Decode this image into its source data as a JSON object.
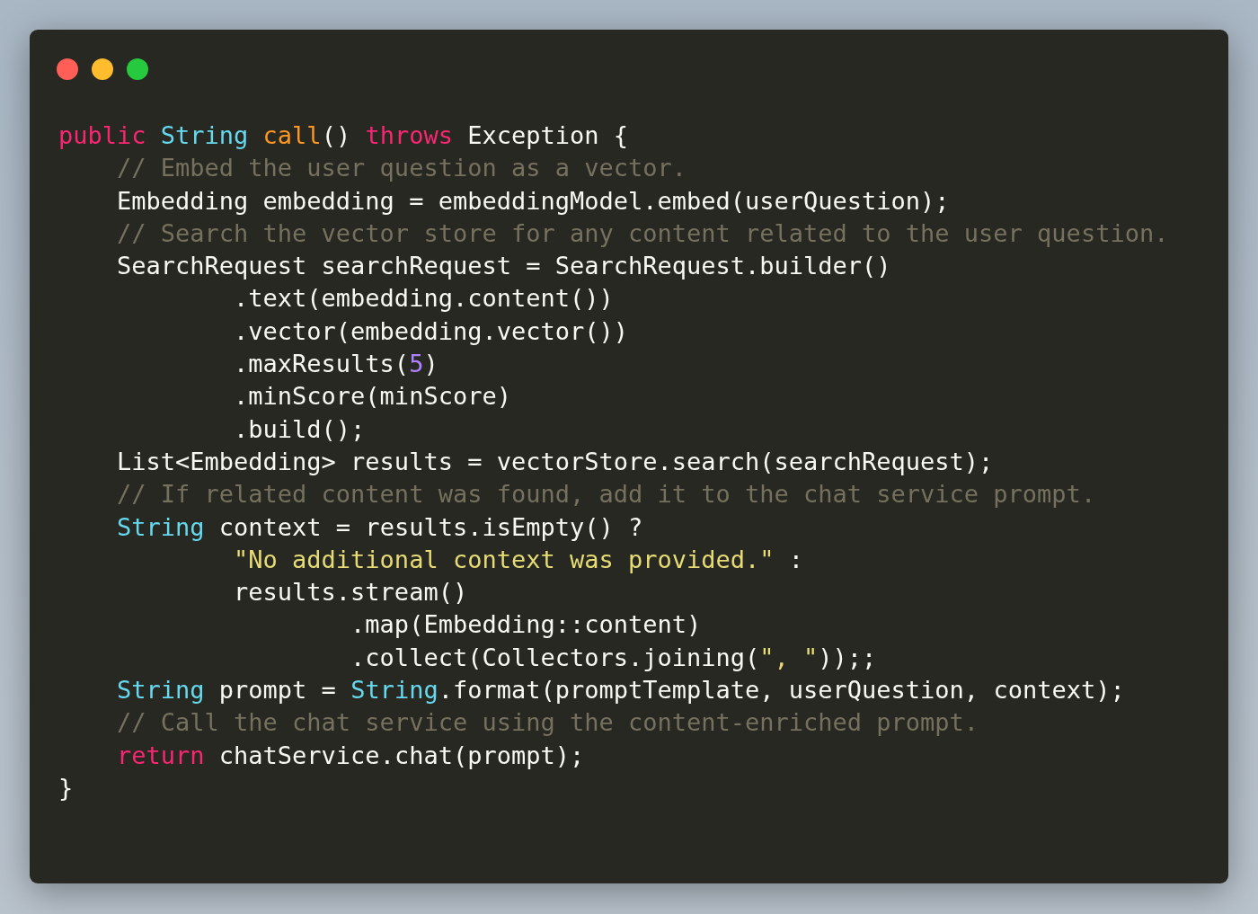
{
  "window": {
    "controls": [
      {
        "color": "#ff5f56"
      },
      {
        "color": "#ffbd2e"
      },
      {
        "color": "#27c93f"
      }
    ]
  },
  "code": [
    {
      "tokens": [
        {
          "kind": "keyword",
          "text": "public"
        },
        {
          "kind": "type",
          "text": " String"
        },
        {
          "kind": "function",
          "text": " call"
        },
        {
          "kind": "plain",
          "text": "() "
        },
        {
          "kind": "keyword",
          "text": "throws"
        },
        {
          "kind": "plain",
          "text": " Exception {"
        }
      ]
    },
    {
      "tokens": [
        {
          "kind": "comment",
          "text": "    // Embed the user question as a vector."
        }
      ]
    },
    {
      "tokens": [
        {
          "kind": "plain",
          "text": "    Embedding embedding = embeddingModel.embed(userQuestion);"
        }
      ]
    },
    {
      "tokens": [
        {
          "kind": "comment",
          "text": "    // Search the vector store for any content related to the user question."
        }
      ]
    },
    {
      "tokens": [
        {
          "kind": "plain",
          "text": "    SearchRequest searchRequest = SearchRequest.builder()"
        }
      ]
    },
    {
      "tokens": [
        {
          "kind": "plain",
          "text": "            .text(embedding.content())"
        }
      ]
    },
    {
      "tokens": [
        {
          "kind": "plain",
          "text": "            .vector(embedding.vector())"
        }
      ]
    },
    {
      "tokens": [
        {
          "kind": "plain",
          "text": "            .maxResults("
        },
        {
          "kind": "number",
          "text": "5"
        },
        {
          "kind": "plain",
          "text": ")"
        }
      ]
    },
    {
      "tokens": [
        {
          "kind": "plain",
          "text": "            .minScore(minScore)"
        }
      ]
    },
    {
      "tokens": [
        {
          "kind": "plain",
          "text": "            .build();"
        }
      ]
    },
    {
      "tokens": [
        {
          "kind": "plain",
          "text": "    List<Embedding> results = vectorStore.search(searchRequest);"
        }
      ]
    },
    {
      "tokens": [
        {
          "kind": "comment",
          "text": "    // If related content was found, add it to the chat service prompt."
        }
      ]
    },
    {
      "tokens": [
        {
          "kind": "type",
          "text": "    String"
        },
        {
          "kind": "plain",
          "text": " context = results.isEmpty() ?"
        }
      ]
    },
    {
      "tokens": [
        {
          "kind": "string",
          "text": "            \"No additional context was provided.\""
        },
        {
          "kind": "plain",
          "text": " :"
        }
      ]
    },
    {
      "tokens": [
        {
          "kind": "plain",
          "text": "            results.stream()"
        }
      ]
    },
    {
      "tokens": [
        {
          "kind": "plain",
          "text": "                    .map(Embedding::content)"
        }
      ]
    },
    {
      "tokens": [
        {
          "kind": "plain",
          "text": "                    .collect(Collectors.joining("
        },
        {
          "kind": "string",
          "text": "\", \""
        },
        {
          "kind": "plain",
          "text": "));;"
        }
      ]
    },
    {
      "tokens": [
        {
          "kind": "type",
          "text": "    String"
        },
        {
          "kind": "plain",
          "text": " prompt = "
        },
        {
          "kind": "type",
          "text": "String"
        },
        {
          "kind": "plain",
          "text": ".format(promptTemplate, userQuestion, context);"
        }
      ]
    },
    {
      "tokens": [
        {
          "kind": "comment",
          "text": "    // Call the chat service using the content-enriched prompt."
        }
      ]
    },
    {
      "tokens": [
        {
          "kind": "keyword",
          "text": "    return"
        },
        {
          "kind": "plain",
          "text": " chatService.chat(prompt);"
        }
      ]
    },
    {
      "tokens": [
        {
          "kind": "plain",
          "text": "}"
        }
      ]
    }
  ]
}
